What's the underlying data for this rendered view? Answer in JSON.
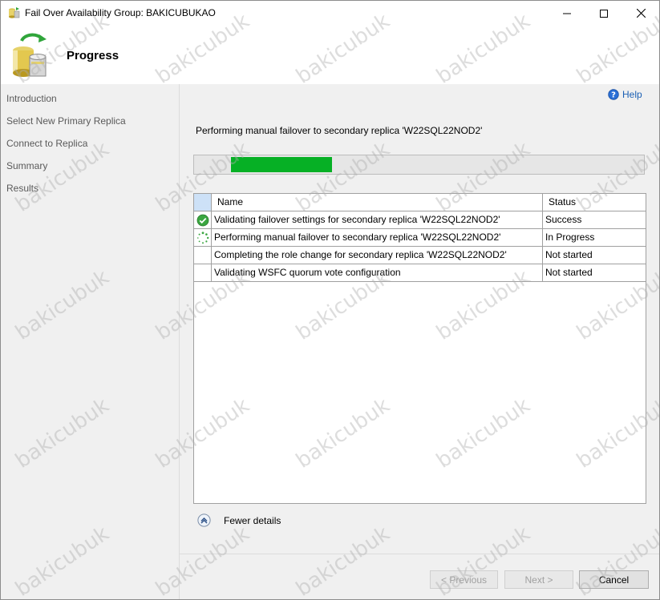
{
  "window": {
    "title": "Fail Over Availability Group: BAKICUBUKAO"
  },
  "header": {
    "title": "Progress"
  },
  "nav": {
    "items": [
      {
        "label": "Introduction"
      },
      {
        "label": "Select New Primary Replica"
      },
      {
        "label": "Connect to Replica"
      },
      {
        "label": "Summary"
      },
      {
        "label": "Results"
      }
    ]
  },
  "help": {
    "label": "Help"
  },
  "status_line": "Performing manual failover to secondary replica 'W22SQL22NOD2'",
  "progress": {
    "fraction": 0.225,
    "color": "#06b025"
  },
  "table": {
    "columns": {
      "name": "Name",
      "status": "Status"
    },
    "rows": [
      {
        "name": "Validating failover settings for secondary replica 'W22SQL22NOD2'",
        "status": "Success",
        "icon": "success-check-icon"
      },
      {
        "name": "Performing manual failover to secondary replica 'W22SQL22NOD2'",
        "status": "In Progress",
        "icon": "in-progress-spinner-icon"
      },
      {
        "name": "Completing the role change for secondary replica 'W22SQL22NOD2'",
        "status": "Not started",
        "icon": ""
      },
      {
        "name": "Validating WSFC quorum vote configuration",
        "status": "Not started",
        "icon": ""
      }
    ]
  },
  "details_toggle": {
    "label": "Fewer details",
    "icon": "collapse-up-icon"
  },
  "buttons": {
    "previous": "< Previous",
    "next": "Next >",
    "cancel": "Cancel"
  },
  "watermark": {
    "text": "bakicubuk"
  }
}
